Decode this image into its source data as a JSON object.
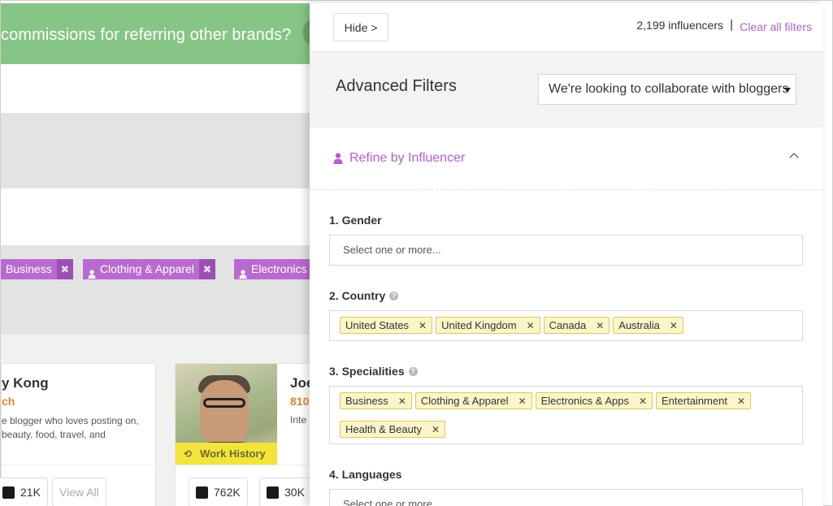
{
  "banner": {
    "text": "commissions for referring other brands?"
  },
  "background_tags": [
    {
      "label": "Business",
      "has_icon": false
    },
    {
      "label": "Clothing & Apparel",
      "has_icon": true
    },
    {
      "label": "Electronics",
      "has_icon": true
    }
  ],
  "cards": [
    {
      "name": "y Kong",
      "subtitle": "ch",
      "description": "e blogger who loves posting on, beauty, food, travel, and",
      "stats": [
        {
          "icon": "twitter-icon",
          "value": "21K"
        }
      ],
      "view_all": "View All"
    },
    {
      "name": "Joe",
      "subtitle": "810",
      "description": "Inte",
      "badge": "Work History",
      "stats": [
        {
          "icon": "twitter-icon",
          "value": "762K"
        },
        {
          "icon": "linkedin-icon",
          "value": "30K"
        }
      ]
    }
  ],
  "panel": {
    "hide_button": "Hide >",
    "count": "2,199 influencers",
    "separator": "|",
    "clear_filters": "Clear all filters",
    "title": "Advanced Filters",
    "collab_select": "We're looking to collaborate with bloggers",
    "refine_title": "Refine by Influencer",
    "filters": {
      "gender": {
        "label": "1. Gender",
        "placeholder": "Select one or more..."
      },
      "country": {
        "label": "2. Country",
        "chips": [
          "United States",
          "United Kingdom",
          "Canada",
          "Australia"
        ]
      },
      "specialities": {
        "label": "3. Specialities",
        "chips": [
          "Business",
          "Clothing & Apparel",
          "Electronics & Apps",
          "Entertainment",
          "Health & Beauty"
        ]
      },
      "languages": {
        "label": "4. Languages",
        "placeholder": "Select one or more..."
      }
    }
  },
  "colors": {
    "accent": "#b560cc",
    "banner": "#86c585",
    "chip_bg": "#fbf6c8",
    "work_history": "#f3e43c",
    "orange": "#e8862c"
  }
}
